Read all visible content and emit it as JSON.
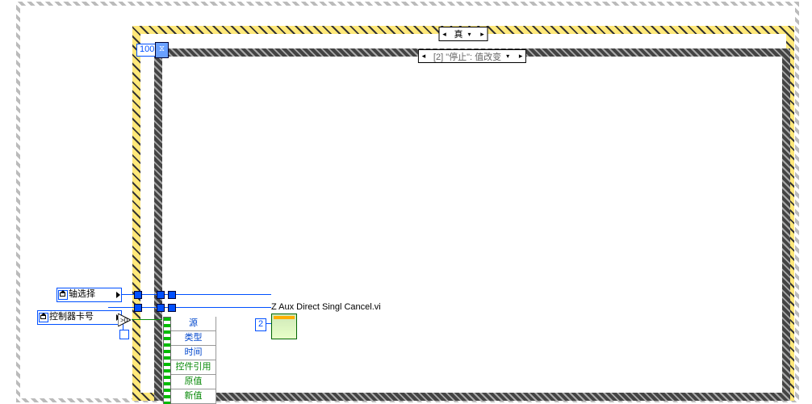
{
  "outer_case": {
    "selector_value": "真",
    "selector_prev": "◂",
    "selector_next": "▸",
    "selector_drop": "▾"
  },
  "event_structure": {
    "selector_prefix": "[2]",
    "selector_value": "\"停止\": 值改变",
    "selector_prev": "◂",
    "selector_next": "▸",
    "selector_drop": "▾",
    "timeout_constant": "100",
    "timeout_icon": "⧖"
  },
  "locals": {
    "axis": "轴选择",
    "card": "控制器卡号"
  },
  "compare": {
    "op": ">0",
    "ge_const_label": ""
  },
  "subvi": {
    "label": "Z Aux Direct Singl Cancel.vi",
    "const": "2"
  },
  "event_fields": [
    "源",
    "类型",
    "时间",
    "控件引用",
    "原值",
    "新值"
  ]
}
